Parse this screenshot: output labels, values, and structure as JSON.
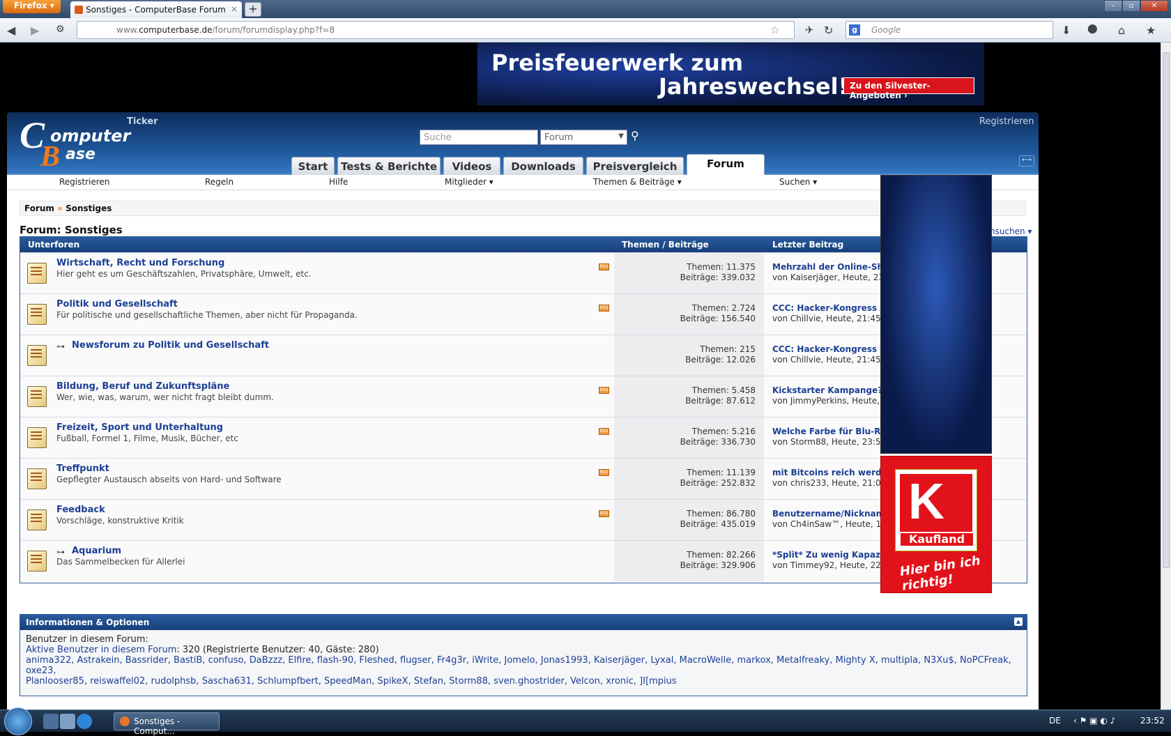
{
  "browser": {
    "menu_button": "Firefox",
    "tab_title": "Sonstiges - ComputerBase Forum",
    "url_prefix": "www.",
    "url_domain": "computerbase.de",
    "url_path": "/forum/forumdisplay.php?f=8",
    "search_placeholder": "Google"
  },
  "banner": {
    "line1": "Preisfeuerwerk zum",
    "line2": "Jahreswechsel!",
    "cta": "Zu den Silvester-Angeboten ›"
  },
  "header": {
    "ticker": "Ticker",
    "register": "Registrieren",
    "search_placeholder": "Suche",
    "search_scope": "Forum",
    "tabs": [
      "Start",
      "Tests & Berichte",
      "Videos",
      "Downloads",
      "Preisvergleich",
      "Forum"
    ]
  },
  "subnav": [
    "Registrieren",
    "Regeln",
    "Hilfe",
    "Mitglieder ▾",
    "Themen & Beiträge ▾",
    "Suchen ▾"
  ],
  "breadcrumb": {
    "root": "Forum",
    "sep": "»",
    "current": "Sonstiges"
  },
  "page_title": "Forum: Sonstiges",
  "forum_search": "hsuchen ▾",
  "table": {
    "col_forum": "Unterforen",
    "col_stats": "Themen / Beiträge",
    "col_last": "Letzter Beitrag",
    "rows": [
      {
        "title": "Wirtschaft, Recht und Forschung",
        "desc": "Hier geht es um Geschäftszahlen, Privatsphäre, Umwelt, etc.",
        "themen": "Themen: 11.375",
        "beitraege": "Beiträge: 339.032",
        "last_title": "Mehrzahl der Online-Sho",
        "last_by": "von Kaiserjäger, Heute, 23"
      },
      {
        "title": "Politik und Gesellschaft",
        "desc": "Für politische und gesellschaftliche Themen, aber nicht für Propaganda.",
        "themen": "Themen: 2.724",
        "beitraege": "Beiträge: 156.540",
        "last_title": "CCC: Hacker-Kongress m",
        "last_by": "von Chillvie, Heute, 21:45"
      },
      {
        "title": "Newsforum zu Politik und Gesellschaft",
        "desc": "",
        "themen": "Themen: 215",
        "beitraege": "Beiträge: 12.026",
        "last_title": "CCC: Hacker-Kongress m",
        "last_by": "von Chillvie, Heute, 21:45"
      },
      {
        "title": "Bildung, Beruf und Zukunftspläne",
        "desc": "Wer, wie, was, warum, wer nicht fragt bleibt dumm.",
        "themen": "Themen: 5.458",
        "beitraege": "Beiträge: 87.612",
        "last_title": "Kickstarter Kampange?",
        "last_by": "von JimmyPerkins, Heute, 2"
      },
      {
        "title": "Freizeit, Sport und Unterhaltung",
        "desc": "Fußball, Formel 1, Filme, Musik, Bücher, etc",
        "themen": "Themen: 5.216",
        "beitraege": "Beiträge: 336.730",
        "last_title": "Welche Farbe für Blu-Ra",
        "last_by": "von Storm88, Heute, 23:51"
      },
      {
        "title": "Treffpunkt",
        "desc": "Gepflegter Austausch abseits von Hard- und Software",
        "themen": "Themen: 11.139",
        "beitraege": "Beiträge: 252.832",
        "last_title": "mit Bitcoins reich werde",
        "last_by": "von chris233, Heute, 21:05"
      },
      {
        "title": "Feedback",
        "desc": "Vorschläge, konstruktive Kritik",
        "themen": "Themen: 86.780",
        "beitraege": "Beiträge: 435.019",
        "last_title": "Benutzername/Nickname ändern...",
        "last_by": "von Ch4inSaw™, Heute, 15:17"
      },
      {
        "title": "Aquarium",
        "desc": "Das Sammelbecken für Allerlei",
        "themen": "Themen: 82.266",
        "beitraege": "Beiträge: 329.906",
        "last_title": "*Split* Zu wenig Kapazität...",
        "last_by": "von Timmey92, Heute, 22:09"
      }
    ]
  },
  "info": {
    "title": "Informationen & Optionen",
    "users_label": "Benutzer in diesem Forum:",
    "active_link": "Aktive Benutzer in diesem Forum",
    "active_count": ": 320 (Registrierte Benutzer: 40, Gäste: 280)",
    "users_line1": "anima322, Astrakein, Bassrider, BastiB, confuso, DaBzzz, Elfire, flash-90, Fleshed, flugser, Fr4g3r, iWrite, Jomelo, Jonas1993, Kaiserjäger, Lyxal, MacroWelle, markox, Metalfreaky, Mighty X, multipla, N3Xu$, NoPCFreak, oxe23,",
    "users_line2": "Planlooser85, reiswaffel02, rudolphsb, Sascha631, Schlumpfbert, SpeedMan, SpikeX, Stefan, Storm88, sven.ghostrider, Velcon, xronic, ]I[mpius"
  },
  "ads": {
    "kaufland_brand": "Kaufland",
    "kaufland_slogan": "Hier bin ich richtig!"
  },
  "taskbar": {
    "task_title": "Sonstiges - Comput...",
    "lang": "DE",
    "time": "23:52"
  }
}
